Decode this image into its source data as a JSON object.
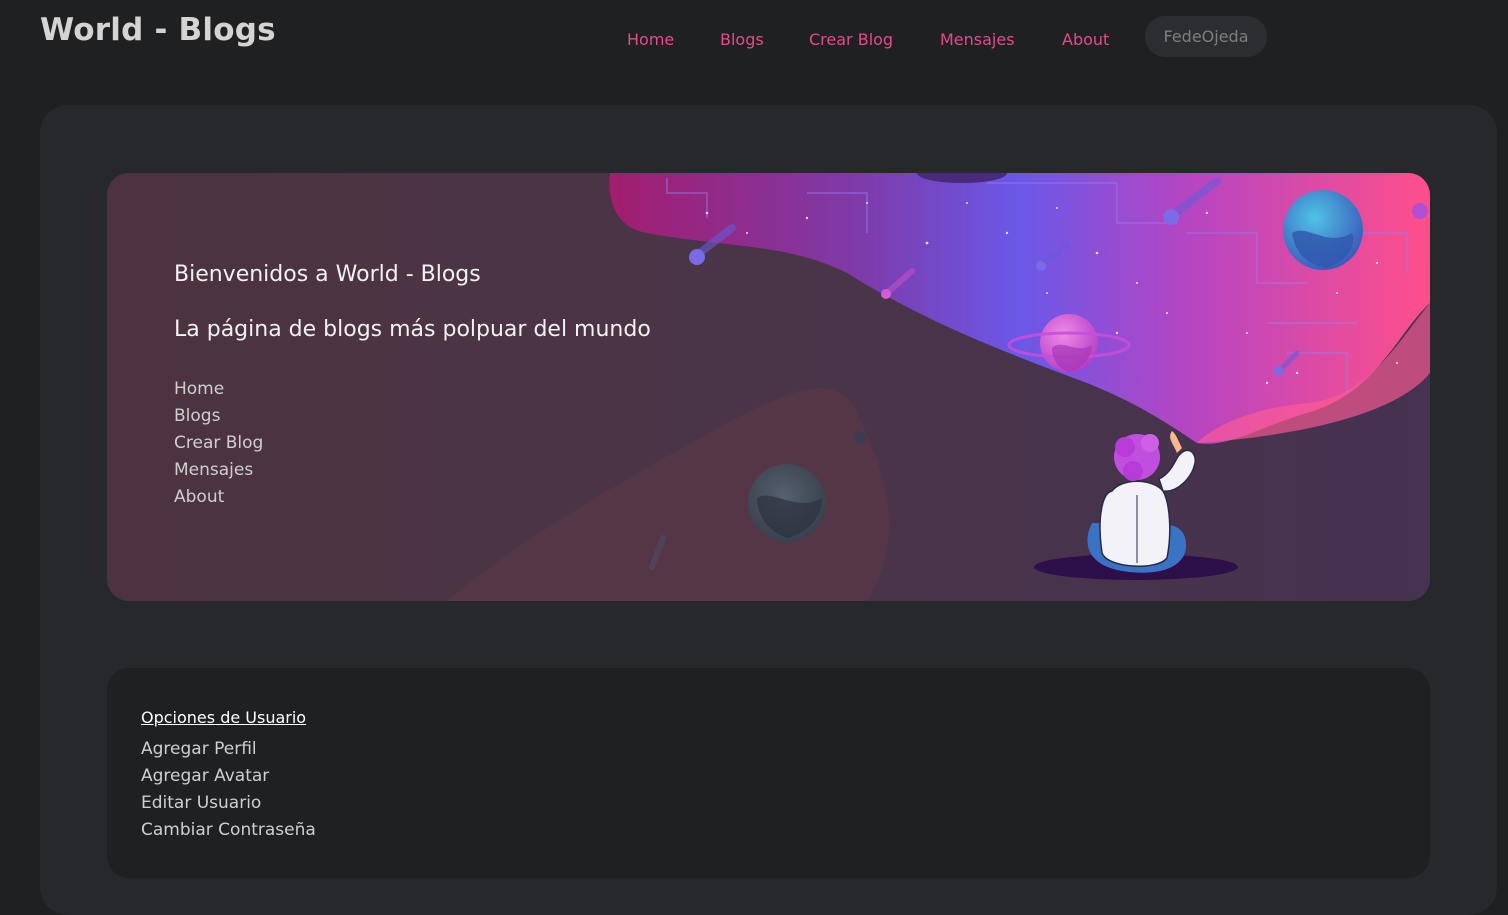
{
  "header": {
    "brand": "World - Blogs",
    "nav": [
      "Home",
      "Blogs",
      "Crear Blog",
      "Mensajes",
      "About"
    ],
    "user": "FedeOjeda"
  },
  "hero": {
    "title": "Bienvenidos a World - Blogs",
    "subtitle": "La página de blogs más polpuar del mundo",
    "links": [
      "Home",
      "Blogs",
      "Crear Blog",
      "Mensajes",
      "About"
    ],
    "illustration": "space-galaxy-person-illustration"
  },
  "options": {
    "title": "Opciones de Usuario",
    "links": [
      "Agregar Perfil",
      "Agregar Avatar",
      "Editar Usuario",
      "Cambiar Contraseña"
    ]
  },
  "colors": {
    "accent": "#e84a8a",
    "background": "#1f2022",
    "card": "#27282b"
  }
}
